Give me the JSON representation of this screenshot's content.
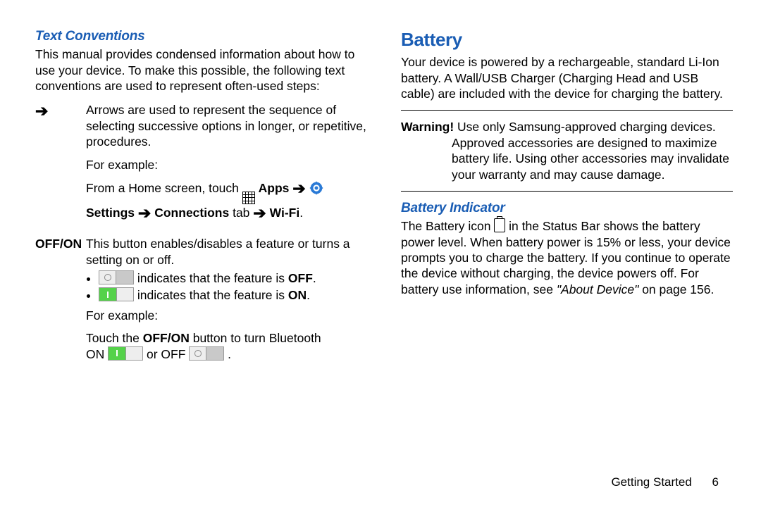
{
  "left": {
    "heading": "Text Conventions",
    "intro": "This manual provides condensed information about how to use your device. To make this possible, the following text conventions are used to represent often-used steps:",
    "arrow_symbol": "➔",
    "arrow_desc": "Arrows are used to represent the sequence of selecting successive options in longer, or repetitive, procedures.",
    "for_example": "For example:",
    "example_lead": "From a Home screen, touch ",
    "apps_label": "Apps",
    "settings_label": "Settings",
    "connections_label": "Connections",
    "tab_word": " tab ",
    "wifi_label": "Wi-Fi",
    "period": ".",
    "offon_key": "OFF/ON",
    "offon_desc": "This button enables/disables a feature or turns a setting on or off.",
    "bullet_off_pre": " indicates that the feature is ",
    "off_word": "OFF",
    "bullet_on_pre": " indicates that the feature is ",
    "on_word": "ON",
    "example2_lead": "Touch the ",
    "offon_bold": "OFF/ON",
    "example2_mid": " button to turn Bluetooth ",
    "on_caps": "ON ",
    "or_word": " or OFF "
  },
  "right": {
    "heading_main": "Battery",
    "intro": "Your device is powered by a rechargeable, standard Li-Ion battery. A Wall/USB Charger (Charging Head and USB cable) are included with the device for charging the battery.",
    "warning_label": "Warning!",
    "warning_text": " Use only Samsung-approved charging devices. Approved accessories are designed to maximize battery life. Using other accessories may invalidate your warranty and may cause damage.",
    "heading_sub": "Battery Indicator",
    "batt_pre": "The Battery icon ",
    "batt_post": " in the Status Bar shows the battery power level. When battery power is 15% or less, your device prompts you to charge the battery. If you continue to operate the device without charging, the device powers off. For battery use information, see ",
    "about_device": "\"About Device\"",
    "on_page": " on page 156."
  },
  "footer": {
    "section": "Getting Started",
    "page": "6"
  }
}
